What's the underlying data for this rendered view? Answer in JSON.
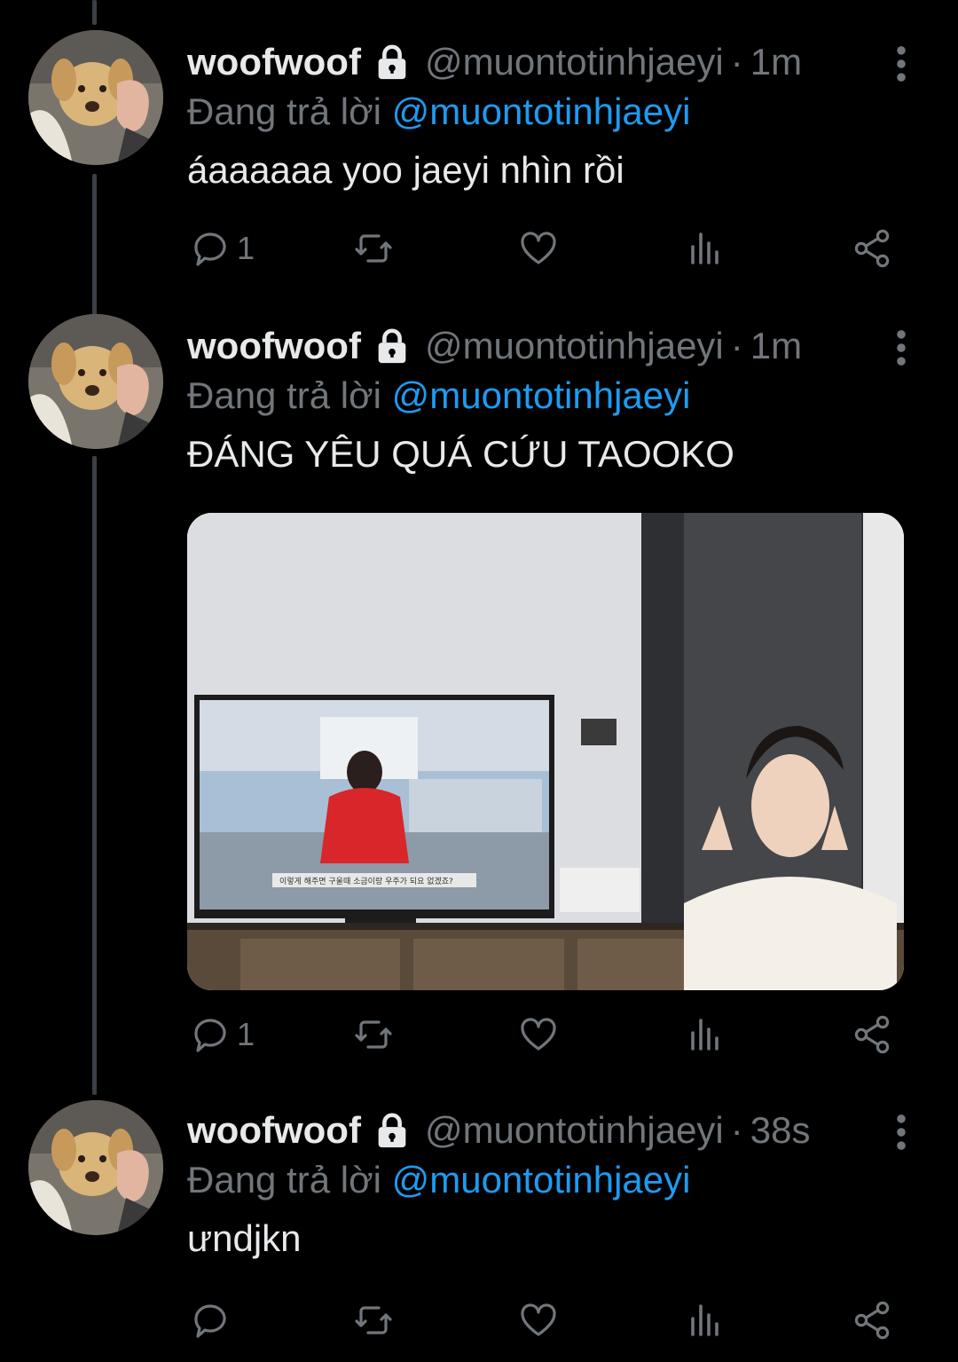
{
  "tweets": [
    {
      "display_name": "woofwoof",
      "handle": "@muontotinhjaeyi",
      "dot": "·",
      "time": "1m",
      "reply_prefix": "Đang trả lời ",
      "reply_mention": "@muontotinhjaeyi",
      "text": "áaaaaaa yoo jaeyi nhìn rồi",
      "reply_count": "1"
    },
    {
      "display_name": "woofwoof",
      "handle": "@muontotinhjaeyi",
      "dot": "·",
      "time": "1m",
      "reply_prefix": "Đang trả lời ",
      "reply_mention": "@muontotinhjaeyi",
      "text": "ĐÁNG YÊU QUÁ CỨU TAOOKO",
      "reply_count": "1",
      "media_caption": "이렇게 해주면 구울때 소금이랑 우주가 되요 없겠죠?"
    },
    {
      "display_name": "woofwoof",
      "handle": "@muontotinhjaeyi",
      "dot": "·",
      "time": "38s",
      "reply_prefix": "Đang trả lời ",
      "reply_mention": "@muontotinhjaeyi",
      "text": "ưndjkn",
      "reply_count": ""
    }
  ],
  "icons": {
    "lock": "lock-icon",
    "more": "more-vertical-icon",
    "reply": "reply-icon",
    "retweet": "retweet-icon",
    "like": "like-icon",
    "views": "views-icon",
    "share": "share-icon"
  },
  "colors": {
    "background": "#000000",
    "text": "#e7e9ea",
    "muted": "#71767b",
    "link": "#1d9bf0",
    "thread_line": "#3b4045"
  }
}
